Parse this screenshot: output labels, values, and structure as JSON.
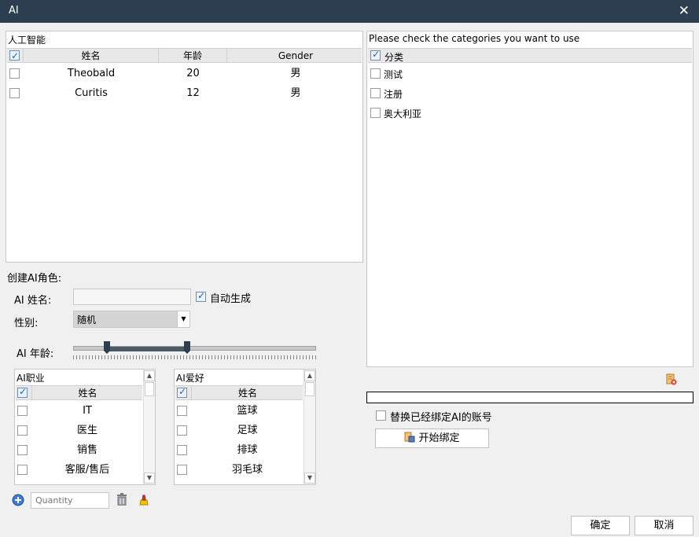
{
  "window": {
    "title": "AI",
    "close_glyph": "✕"
  },
  "ai_list": {
    "title": "人工智能",
    "columns": [
      "姓名",
      "年龄",
      "Gender"
    ],
    "rows": [
      {
        "name": "Theobald",
        "age": "20",
        "gender": "男"
      },
      {
        "name": "Curitis",
        "age": "12",
        "gender": "男"
      }
    ]
  },
  "categories": {
    "title": "Please check the categories you want to use",
    "header": "分类",
    "items": [
      "测试",
      "注册",
      "奥大利亚"
    ]
  },
  "create": {
    "section_title": "创建AI角色:",
    "name_label": "AI 姓名:",
    "name_value": "",
    "auto_label": "自动生成",
    "gender_label": "性别:",
    "gender_value": "随机",
    "age_label": "AI 年龄:",
    "age_range": {
      "min": 0,
      "max": 100,
      "low": 14,
      "high": 47
    }
  },
  "jobs": {
    "title": "AI职业",
    "header": "姓名",
    "items": [
      "IT",
      "医生",
      "销售",
      "客服/售后"
    ]
  },
  "hobbies": {
    "title": "AI爱好",
    "header": "姓名",
    "items": [
      "篮球",
      "足球",
      "排球",
      "羽毛球"
    ]
  },
  "bottom_tools": {
    "quantity_placeholder": "Quantity"
  },
  "binding": {
    "replace_label": "替换已经绑定AI的账号",
    "start_button": "开始绑定"
  },
  "footer": {
    "ok": "确定",
    "cancel": "取消"
  },
  "colors": {
    "titlebar": "#2c3e50",
    "accent": "#2b5fa6"
  }
}
